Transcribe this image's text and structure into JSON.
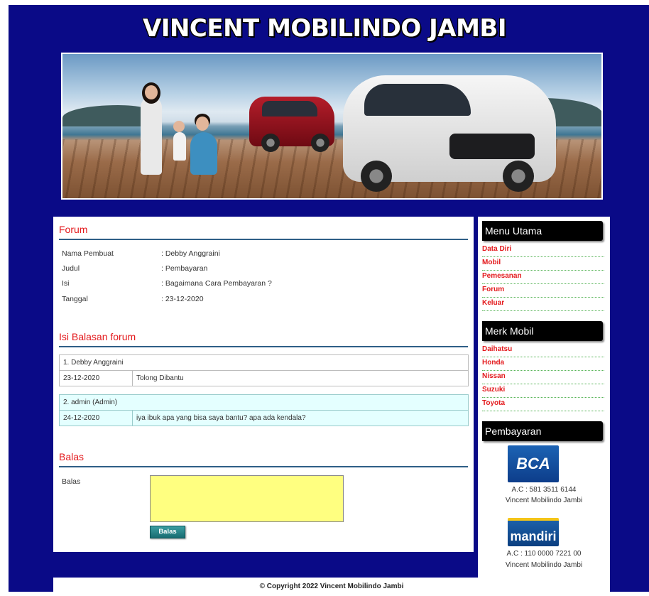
{
  "site": {
    "title": "VINCENT MOBILINDO JAMBI"
  },
  "forum": {
    "heading": "Forum",
    "rows": [
      {
        "label": "Nama Pembuat",
        "value": ": Debby Anggraini"
      },
      {
        "label": "Judul",
        "value": ": Pembayaran"
      },
      {
        "label": "Isi",
        "value": ": Bagaimana Cara Pembayaran ?"
      },
      {
        "label": "Tanggal",
        "value": ": 23-12-2020"
      }
    ]
  },
  "replies": {
    "heading": "Isi Balasan forum",
    "items": [
      {
        "author": "1. Debby Anggraini",
        "date": "23-12-2020",
        "message": "Tolong Dibantu"
      },
      {
        "author": "2. admin (Admin)",
        "date": "24-12-2020",
        "message": "iya ibuk apa yang bisa saya bantu? apa ada kendala?"
      }
    ]
  },
  "reply_form": {
    "heading": "Balas",
    "label": "Balas",
    "value": "",
    "button": "Balas"
  },
  "sidebar": {
    "menu_title": "Menu Utama",
    "menu": [
      "Data Diri",
      "Mobil",
      "Pemesanan",
      "Forum",
      "Keluar"
    ],
    "brand_title": "Merk Mobil",
    "brands": [
      "Daihatsu",
      "Honda",
      "Nissan",
      "Suzuki",
      "Toyota"
    ],
    "payment_title": "Pembayaran",
    "banks": [
      {
        "name": "BCA",
        "account": "A.C : 581 3511 6144",
        "holder": "Vincent Mobilindo Jambi"
      },
      {
        "name": "mandiri",
        "account": "A.C : 110 0000 7221 00",
        "holder": "Vincent Mobilindo Jambi"
      }
    ]
  },
  "footer": {
    "text": "© Copyright 2022 Vincent Mobilindo Jambi"
  },
  "colors": {
    "background": "#0a0a87",
    "accent": "#e3191c",
    "rule": "#2f5f87",
    "textarea": "#ffff80"
  }
}
